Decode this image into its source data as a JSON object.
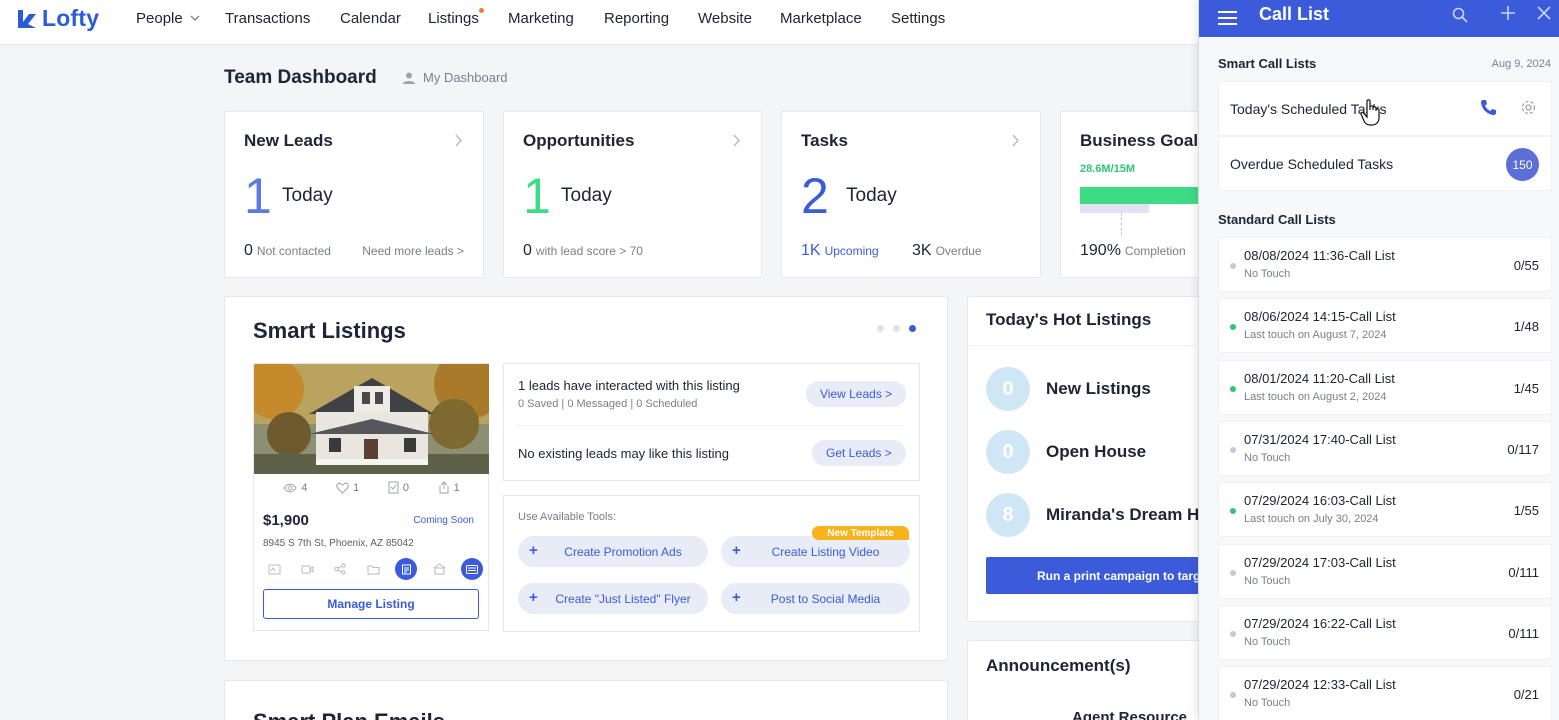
{
  "nav": {
    "logo": "Lofty",
    "items": [
      {
        "label": "People"
      },
      {
        "label": "Transactions"
      },
      {
        "label": "Calendar"
      },
      {
        "label": "Listings"
      },
      {
        "label": "Marketing"
      },
      {
        "label": "Reporting"
      },
      {
        "label": "Website"
      },
      {
        "label": "Marketplace"
      },
      {
        "label": "Settings"
      }
    ]
  },
  "dashboard": {
    "title": "Team Dashboard",
    "switch_label": "My Dashboard"
  },
  "stats": {
    "new_leads": {
      "title": "New Leads",
      "big": "1",
      "today": "Today",
      "foot_num": "0",
      "foot_text": "Not contacted",
      "right_link": "Need more leads >"
    },
    "opportunities": {
      "title": "Opportunities",
      "big": "1",
      "today": "Today",
      "foot_num": "0",
      "foot_text": "with lead score > 70"
    },
    "tasks": {
      "title": "Tasks",
      "big": "2",
      "today": "Today",
      "upcoming_num": "1K",
      "upcoming_text": "Upcoming",
      "overdue_num": "3K",
      "overdue_text": "Overdue"
    },
    "business_goal": {
      "title": "Business Goal",
      "amount": "28.6M/15M",
      "foot_num": "190%",
      "foot_text": "Completion",
      "progress": 1.0
    }
  },
  "smart_listings": {
    "title": "Smart Listings",
    "metrics": {
      "views": "4",
      "likes": "1",
      "tasks": "0",
      "shares": "1"
    },
    "price": "$1,900",
    "status": "Coming Soon",
    "address": "8945 S 7th St, Phoenix, AZ 85042",
    "manage_label": "Manage Listing",
    "leads_interacted": "1 leads have interacted with this listing",
    "leads_sub": "0 Saved | 0 Messaged | 0 Scheduled",
    "view_leads": "View Leads >",
    "no_leads": "No existing leads may like this listing",
    "get_leads": "Get Leads >",
    "tools_label": "Use Available Tools:",
    "tools": {
      "promo": "Create Promotion Ads",
      "video": "Create Listing Video",
      "flyer": "Create \"Just Listed\" Flyer",
      "social": "Post to Social Media"
    },
    "new_template": "New Template"
  },
  "hot_listings": {
    "title": "Today's Hot Listings",
    "rows": [
      {
        "count": "0",
        "label": "New Listings"
      },
      {
        "count": "0",
        "label": "Open House"
      },
      {
        "count": "8",
        "label": "Miranda's Dream H"
      }
    ],
    "print_label": "Run a print campaign to targ"
  },
  "announcements": {
    "title": "Announcement(s)",
    "agent_resources": "Agent Resource"
  },
  "smart_plan": {
    "title": "Smart Plan Emails"
  },
  "call_list": {
    "title": "Call List",
    "smart_header": "Smart Call Lists",
    "date": "Aug 9, 2024",
    "smart_rows": [
      {
        "label": "Today's Scheduled Tasks"
      },
      {
        "label": "Overdue Scheduled Tasks",
        "badge": "150"
      }
    ],
    "standard_header": "Standard Call Lists",
    "rows": [
      {
        "name": "08/08/2024 11:36-Call List",
        "sub": "No Touch",
        "count": "0/55",
        "touched": false
      },
      {
        "name": "08/06/2024 14:15-Call List",
        "sub": "Last touch on August 7, 2024",
        "count": "1/48",
        "touched": true
      },
      {
        "name": "08/01/2024 11:20-Call List",
        "sub": "Last touch on August 2, 2024",
        "count": "1/45",
        "touched": true
      },
      {
        "name": "07/31/2024 17:40-Call List",
        "sub": "No Touch",
        "count": "0/117",
        "touched": false
      },
      {
        "name": "07/29/2024 16:03-Call List",
        "sub": "Last touch on July 30, 2024",
        "count": "1/55",
        "touched": true
      },
      {
        "name": "07/29/2024 17:03-Call List",
        "sub": "No Touch",
        "count": "0/111",
        "touched": false
      },
      {
        "name": "07/29/2024 16:22-Call List",
        "sub": "No Touch",
        "count": "0/111",
        "touched": false
      },
      {
        "name": "07/29/2024 12:33-Call List",
        "sub": "No Touch",
        "count": "0/21",
        "touched": false
      }
    ]
  },
  "colors": {
    "brand": "#3b5bdb",
    "accent_green": "#2fc572",
    "goal_green": "#3ddc84",
    "badge": "#5b6fd6"
  }
}
